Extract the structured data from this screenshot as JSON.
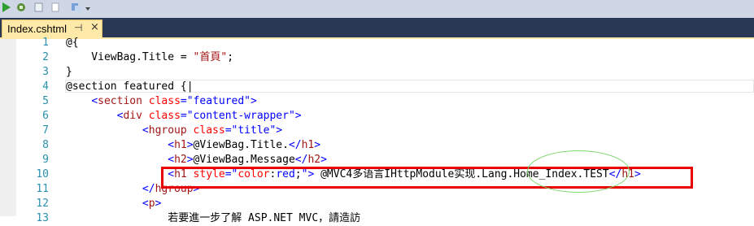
{
  "tab": {
    "label": "Index.cshtml",
    "pin": "⊣",
    "close": "×"
  },
  "toolbar_icons": [
    "run-icon",
    "debug-icon",
    "copy-icon",
    "paste-icon",
    "format-icon"
  ],
  "lines": [
    {
      "n": "1",
      "parts": [
        {
          "c": "k",
          "t": "@{"
        }
      ]
    },
    {
      "n": "2",
      "parts": [
        {
          "c": "k",
          "t": "    ViewBag.Title = "
        },
        {
          "c": "s",
          "t": "\"首頁\""
        },
        {
          "c": "k",
          "t": ";"
        }
      ]
    },
    {
      "n": "3",
      "parts": [
        {
          "c": "k",
          "t": "}"
        }
      ]
    },
    {
      "n": "4",
      "parts": [
        {
          "c": "k",
          "t": "@section featured {|"
        }
      ]
    },
    {
      "n": "5",
      "parts": [
        {
          "c": "k",
          "t": "    "
        },
        {
          "c": "v",
          "t": "<"
        },
        {
          "c": "t",
          "t": "section"
        },
        {
          "c": "k",
          "t": " "
        },
        {
          "c": "a",
          "t": "class"
        },
        {
          "c": "v",
          "t": "=\"featured\">"
        }
      ]
    },
    {
      "n": "6",
      "parts": [
        {
          "c": "k",
          "t": "        "
        },
        {
          "c": "v",
          "t": "<"
        },
        {
          "c": "t",
          "t": "div"
        },
        {
          "c": "k",
          "t": " "
        },
        {
          "c": "a",
          "t": "class"
        },
        {
          "c": "v",
          "t": "=\"content-wrapper\">"
        }
      ]
    },
    {
      "n": "7",
      "parts": [
        {
          "c": "k",
          "t": "            "
        },
        {
          "c": "v",
          "t": "<"
        },
        {
          "c": "t",
          "t": "hgroup"
        },
        {
          "c": "k",
          "t": " "
        },
        {
          "c": "a",
          "t": "class"
        },
        {
          "c": "v",
          "t": "=\"title\">"
        }
      ]
    },
    {
      "n": "8",
      "parts": [
        {
          "c": "k",
          "t": "                "
        },
        {
          "c": "v",
          "t": "<"
        },
        {
          "c": "t",
          "t": "h1"
        },
        {
          "c": "v",
          "t": ">"
        },
        {
          "c": "k",
          "t": "@ViewBag.Title."
        },
        {
          "c": "v",
          "t": "</"
        },
        {
          "c": "t",
          "t": "h1"
        },
        {
          "c": "v",
          "t": ">"
        }
      ]
    },
    {
      "n": "9",
      "parts": [
        {
          "c": "k",
          "t": "                "
        },
        {
          "c": "v",
          "t": "<"
        },
        {
          "c": "t",
          "t": "h2"
        },
        {
          "c": "v",
          "t": ">"
        },
        {
          "c": "k",
          "t": "@ViewBag.Message"
        },
        {
          "c": "v",
          "t": "</"
        },
        {
          "c": "t",
          "t": "h2"
        },
        {
          "c": "v",
          "t": ">"
        }
      ]
    },
    {
      "n": "10",
      "parts": [
        {
          "c": "k",
          "t": "                "
        },
        {
          "c": "v",
          "t": "<"
        },
        {
          "c": "t",
          "t": "h1"
        },
        {
          "c": "k",
          "t": " "
        },
        {
          "c": "a",
          "t": "style"
        },
        {
          "c": "v",
          "t": "=\""
        },
        {
          "c": "a",
          "t": "color"
        },
        {
          "c": "k",
          "t": ":"
        },
        {
          "c": "v",
          "t": "red"
        },
        {
          "c": "k",
          "t": ";"
        },
        {
          "c": "v",
          "t": "\">"
        },
        {
          "c": "k",
          "t": " @MVC4多语言IHttpModule实现.Lang.Home_Index.TEST"
        },
        {
          "c": "v",
          "t": "</"
        },
        {
          "c": "t",
          "t": "h1"
        },
        {
          "c": "v",
          "t": ">"
        }
      ]
    },
    {
      "n": "11",
      "parts": [
        {
          "c": "k",
          "t": "            "
        },
        {
          "c": "v",
          "t": "</"
        },
        {
          "c": "t",
          "t": "hgroup"
        },
        {
          "c": "v",
          "t": ">"
        }
      ]
    },
    {
      "n": "12",
      "parts": [
        {
          "c": "k",
          "t": "            "
        },
        {
          "c": "v",
          "t": "<"
        },
        {
          "c": "t",
          "t": "p"
        },
        {
          "c": "v",
          "t": ">"
        }
      ]
    },
    {
      "n": "13",
      "parts": [
        {
          "c": "k",
          "t": "                若要進一步了解 ASP.NET MVC，請造訪"
        }
      ]
    }
  ],
  "colors": {
    "tab_bg": "#ffe9a8",
    "tabbar_bg": "#293955",
    "line_number": "#2b91af",
    "annotation_box": "#e60000",
    "annotation_ellipse": "#7fd66a"
  }
}
